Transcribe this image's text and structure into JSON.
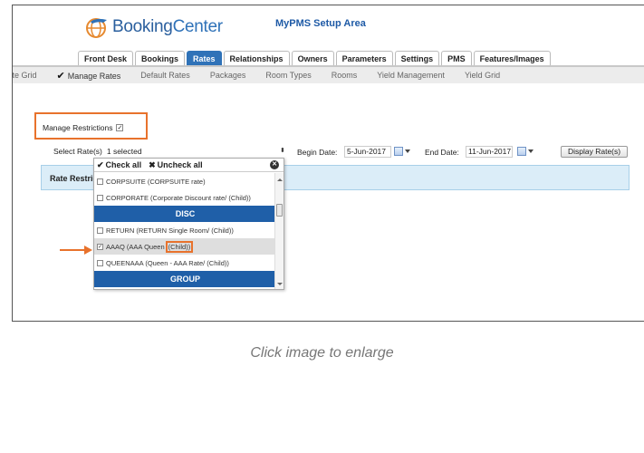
{
  "header": {
    "logo_text_a": "Booking",
    "logo_text_b": "Center",
    "app_title": "MyPMS Setup Area"
  },
  "tabs": [
    {
      "label": "Front Desk",
      "active": false
    },
    {
      "label": "Bookings",
      "active": false
    },
    {
      "label": "Rates",
      "active": true
    },
    {
      "label": "Relationships",
      "active": false
    },
    {
      "label": "Owners",
      "active": false
    },
    {
      "label": "Parameters",
      "active": false
    },
    {
      "label": "Settings",
      "active": false
    },
    {
      "label": "PMS",
      "active": false
    },
    {
      "label": "Features/Images",
      "active": false
    }
  ],
  "subnav": {
    "rate_grid": "Rate Grid",
    "manage_rates": "Manage Rates",
    "default_rates": "Default Rates",
    "packages": "Packages",
    "room_types": "Room Types",
    "rooms": "Rooms",
    "yield_management": "Yield Management",
    "yield_grid": "Yield Grid"
  },
  "form": {
    "manage_restrictions_label": "Manage Restrictions",
    "manage_restrictions_checked": true,
    "select_rates_label": "Select Rate(s)",
    "select_rates_value": "1 selected",
    "begin_date_label": "Begin Date:",
    "begin_date_value": "5-Jun-2017",
    "end_date_label": "End Date:",
    "end_date_value": "11-Jun-2017",
    "display_button": "Display Rate(s)",
    "rate_restrictions_title": "Rate Restricti"
  },
  "dropdown": {
    "check_all": "Check all",
    "uncheck_all": "Uncheck all",
    "items": {
      "corpsuite": "CORPSUITE (CORPSUITE rate)",
      "corporate": "CORPORATE (Corporate Discount rate/ (Child))",
      "group_disc": "DISC",
      "return": "RETURN (RETURN Single Room/ (Child))",
      "aaaq_prefix": "AAAQ (AAA Queen",
      "aaaq_child": "(Child))",
      "queenaaa": "QUEENAAA (Queen - AAA Rate/ (Child))",
      "group_group": "GROUP"
    }
  },
  "caption": "Click image to enlarge",
  "colors": {
    "accent": "#2f72b8",
    "highlight": "#e8722c",
    "group_band": "#1f5fa8",
    "banner": "#dbedf8"
  }
}
